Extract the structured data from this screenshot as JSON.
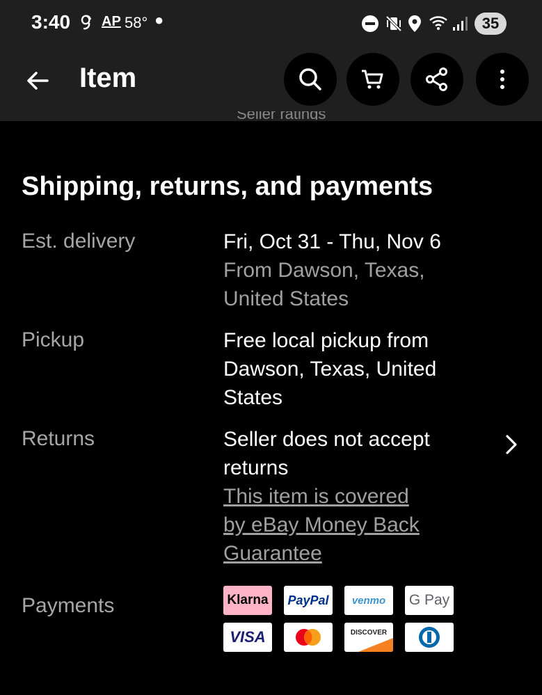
{
  "status_bar": {
    "time": "3:40",
    "indicator_ap": "AP",
    "temperature": "58°",
    "battery": "35"
  },
  "app_bar": {
    "title": "Item"
  },
  "peek_text": "Seller ratings",
  "section": {
    "title": "Shipping, returns, and payments",
    "delivery": {
      "label": "Est. delivery",
      "dates": "Fri, Oct 31 - Thu, Nov 6",
      "origin_line1": "From Dawson, Texas,",
      "origin_line2": "United States"
    },
    "pickup": {
      "label": "Pickup",
      "line1": "Free local pickup from",
      "line2": "Dawson, Texas, United",
      "line3": "States"
    },
    "returns": {
      "label": "Returns",
      "line1": "Seller does not accept",
      "line2": "returns",
      "guarantee_line1": "This item is covered",
      "guarantee_line2": "by eBay Money Back",
      "guarantee_line3": "Guarantee"
    },
    "payments": {
      "label": "Payments",
      "methods": [
        "Klarna",
        "PayPal",
        "venmo",
        "G Pay",
        "VISA",
        "Mastercard",
        "DISCOVER",
        "Diners Club"
      ]
    }
  },
  "colors": {
    "background": "#000000",
    "app_bar": "#1f1f1f",
    "muted_text": "#a0a0a0",
    "klarna_pink": "#ffb3c7",
    "paypal_blue": "#003087",
    "venmo_blue": "#3d95ce",
    "visa_blue": "#1a1f71",
    "discover_orange": "#f68121"
  }
}
